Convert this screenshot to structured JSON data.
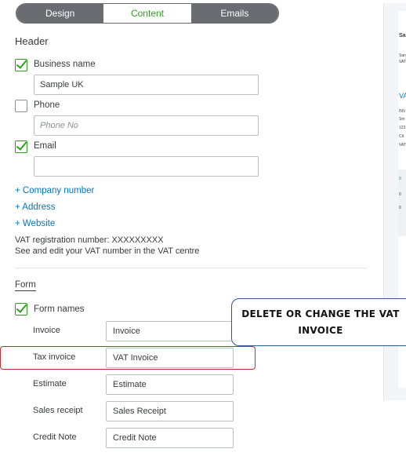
{
  "tabs": [
    {
      "label": "Design"
    },
    {
      "label": "Content"
    },
    {
      "label": "Emails"
    }
  ],
  "header": {
    "title": "Header",
    "business_name": {
      "label": "Business name",
      "checked": true,
      "value": "Sample UK"
    },
    "phone": {
      "label": "Phone",
      "checked": false,
      "placeholder": "Phone No"
    },
    "email": {
      "label": "Email",
      "checked": true,
      "value": ""
    },
    "links": [
      "+ Company number",
      "+ Address",
      "+ Website"
    ],
    "vat_line1": "VAT registration number: XXXXXXXXX",
    "vat_line2": "See and edit your VAT number in the VAT centre"
  },
  "form": {
    "title": "Form",
    "form_names_label": "Form names",
    "form_names_checked": true,
    "rows": [
      {
        "label": "Invoice",
        "value": "Invoice"
      },
      {
        "label": "Tax invoice",
        "value": "VAT Invoice"
      },
      {
        "label": "Estimate",
        "value": "Estimate"
      },
      {
        "label": "Sales receipt",
        "value": "Sales Receipt"
      },
      {
        "label": "Credit Note",
        "value": "Credit Note"
      }
    ]
  },
  "callout": {
    "text": "DELETE OR CHANGE THE VAT INVOICE"
  },
  "preview": {
    "lines": [
      "Sa",
      "San",
      "VAT",
      "VA",
      "INV",
      "Sm",
      "123",
      "Cit",
      "VAT",
      "0",
      "0",
      "0"
    ]
  },
  "colors": {
    "accent": "#2ca01c",
    "link": "#0077c5",
    "highlight": "#c9302c",
    "tab_bg": "#6b6c72"
  }
}
